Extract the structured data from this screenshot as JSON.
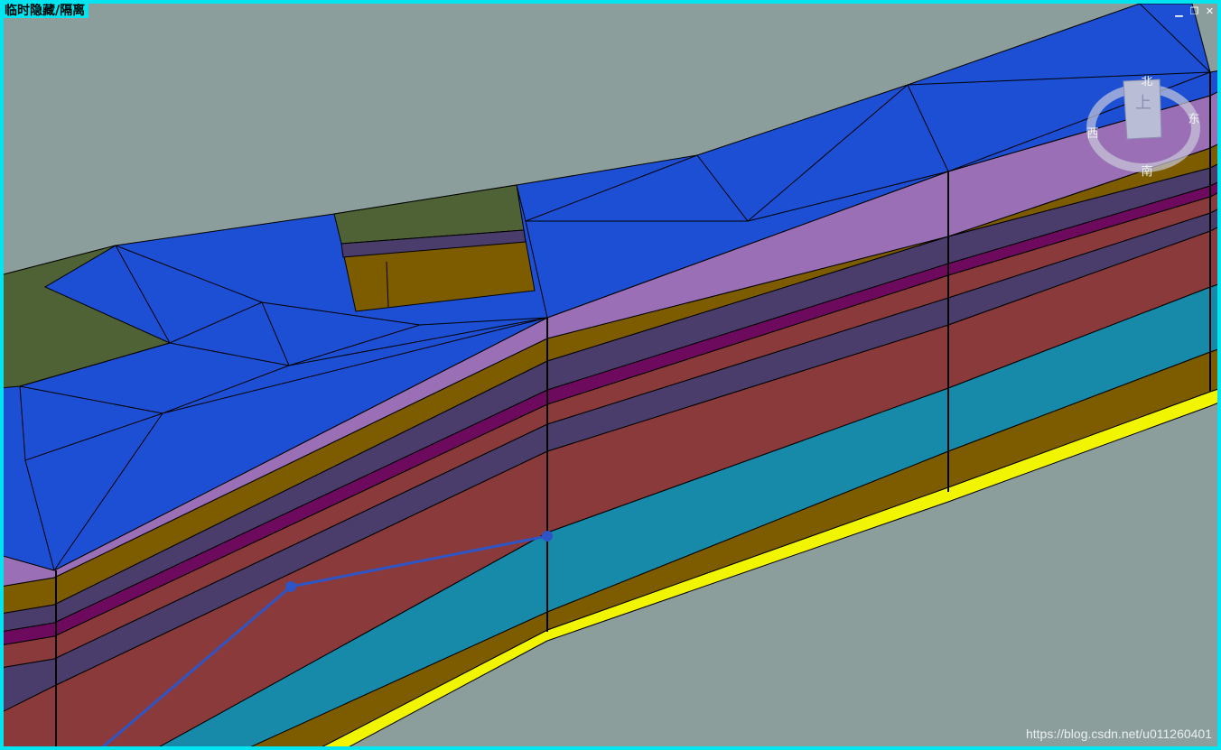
{
  "viewport": {
    "mode_label": "临时隐藏/隔离",
    "watermark": "https://blog.csdn.net/u011260401"
  },
  "window_controls": [
    {
      "name": "minimize",
      "glyph": "▁"
    },
    {
      "name": "restore",
      "glyph": "❐"
    },
    {
      "name": "close",
      "glyph": "✕"
    }
  ],
  "viewcube": {
    "face_label": "上",
    "compass": [
      "东",
      "南",
      "西",
      "北"
    ]
  },
  "colors": {
    "background": "#8c9e9b",
    "frame": "#00e5ef",
    "top_surface": "#1c4fd4",
    "lavender": "#9a6fb6",
    "ochre": "#7d5c00",
    "slate": "#4a3d6b",
    "magenta": "#6d0a5e",
    "brick": "#8b3a3c",
    "teal": "#178aaa",
    "yellow": "#f2f500",
    "moss": "#4f6236"
  }
}
